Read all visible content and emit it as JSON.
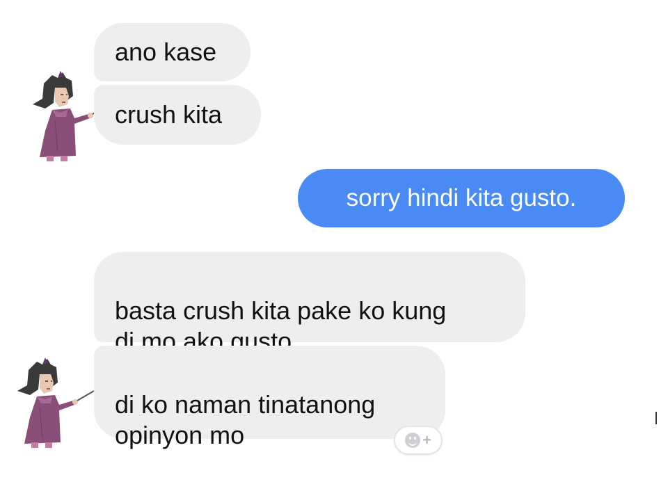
{
  "messages": [
    {
      "direction": "incoming",
      "text": "ano kase"
    },
    {
      "direction": "incoming",
      "text": "crush kita"
    },
    {
      "direction": "outgoing",
      "text": "sorry hindi kita gusto."
    },
    {
      "direction": "incoming",
      "text": "basta crush kita pake ko kung\ndi mo ako gusto"
    },
    {
      "direction": "incoming",
      "text": "di ko naman tinatanong\nopinyon mo"
    }
  ],
  "reaction_button": {
    "icon": "smiley-add-icon",
    "plus": "+"
  },
  "colors": {
    "incoming_bubble": "#eeeeef",
    "outgoing_bubble": "#4a8af4",
    "incoming_text": "#111111",
    "outgoing_text": "#ffffff"
  }
}
